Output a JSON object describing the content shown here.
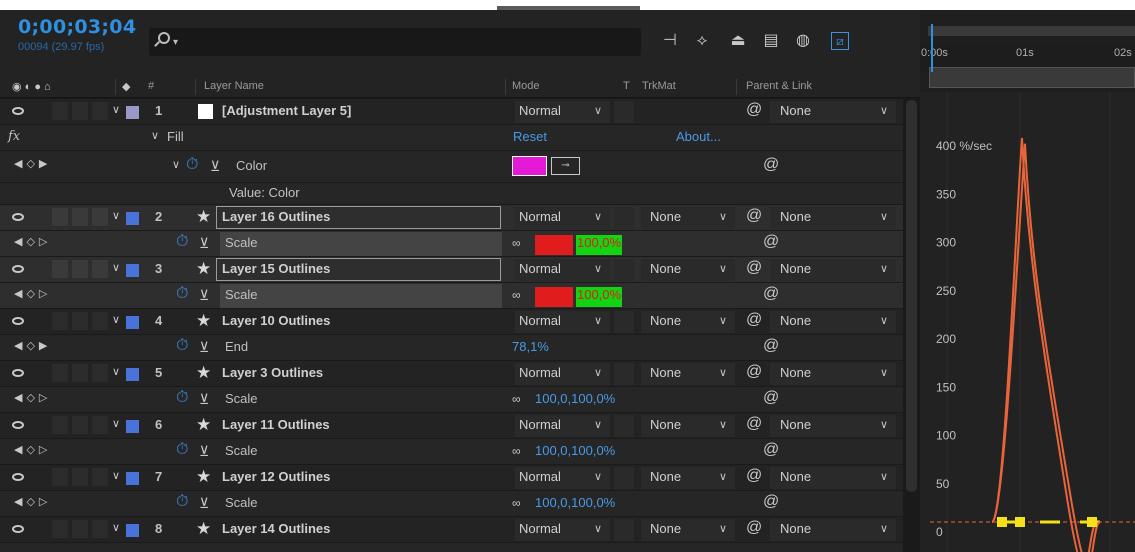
{
  "header": {
    "timecode": "0;00;03;04",
    "frames": "00094 (29.97 fps)",
    "search_placeholder": ""
  },
  "columns": {
    "hash": "#",
    "layer_name": "Layer Name",
    "mode": "Mode",
    "t": "T",
    "trkmat": "TrkMat",
    "parent": "Parent & Link"
  },
  "effect": {
    "fx": "fx",
    "fill": "Fill",
    "reset": "Reset",
    "about": "About...",
    "color_label": "Color",
    "value_label": "Value: Color",
    "swatch_color": "#e41ad7"
  },
  "layers": [
    {
      "num": "1",
      "name": "[Adjustment Layer 5]",
      "mode": "Normal",
      "trkmat": "",
      "parent": "None",
      "label_color": "#9a98c8",
      "selected": false
    },
    {
      "num": "2",
      "name": "Layer 16 Outlines",
      "mode": "Normal",
      "trkmat": "None",
      "parent": "None",
      "label_color": "#4a73d9",
      "selected": true
    },
    {
      "num": "3",
      "name": "Layer 15 Outlines",
      "mode": "Normal",
      "trkmat": "None",
      "parent": "None",
      "label_color": "#4a73d9",
      "selected": true
    },
    {
      "num": "4",
      "name": "Layer 10 Outlines",
      "mode": "Normal",
      "trkmat": "None",
      "parent": "None",
      "label_color": "#4a73d9",
      "selected": false
    },
    {
      "num": "5",
      "name": "Layer 3 Outlines",
      "mode": "Normal",
      "trkmat": "None",
      "parent": "None",
      "label_color": "#4a73d9",
      "selected": false
    },
    {
      "num": "6",
      "name": "Layer 11 Outlines",
      "mode": "Normal",
      "trkmat": "None",
      "parent": "None",
      "label_color": "#4a73d9",
      "selected": false
    },
    {
      "num": "7",
      "name": "Layer 12 Outlines",
      "mode": "Normal",
      "trkmat": "None",
      "parent": "None",
      "label_color": "#4a73d9",
      "selected": false
    },
    {
      "num": "8",
      "name": "Layer 14 Outlines",
      "mode": "Normal",
      "trkmat": "None",
      "parent": "None",
      "label_color": "#4a73d9",
      "selected": false
    }
  ],
  "props": {
    "scale": "Scale",
    "end": "End",
    "scale_x_hi": "100,0,",
    "scale_y_hi": "100,0%",
    "scale_full": "100,0,100,0%",
    "end_value": "78,1%"
  },
  "timeline": {
    "ticks": [
      "0:00s",
      "01s",
      "02s"
    ],
    "rate_label": "400 %/sec",
    "grid_labels": [
      "350",
      "300",
      "250",
      "200",
      "150",
      "100",
      "50",
      "0"
    ]
  },
  "chart_data": {
    "type": "line",
    "title": "",
    "ylabel": "%/sec",
    "y_ticks": [
      0,
      50,
      100,
      150,
      200,
      250,
      300,
      350,
      400
    ],
    "series": [
      {
        "x": [
          0.0,
          0.2,
          0.35,
          0.5,
          0.7
        ],
        "values": [
          0,
          398,
          170,
          25,
          0
        ]
      },
      {
        "x": [
          0.0,
          0.22,
          0.36,
          0.52,
          0.72
        ],
        "values": [
          0,
          392,
          180,
          30,
          0
        ]
      }
    ],
    "line_color": "#e8653b"
  }
}
